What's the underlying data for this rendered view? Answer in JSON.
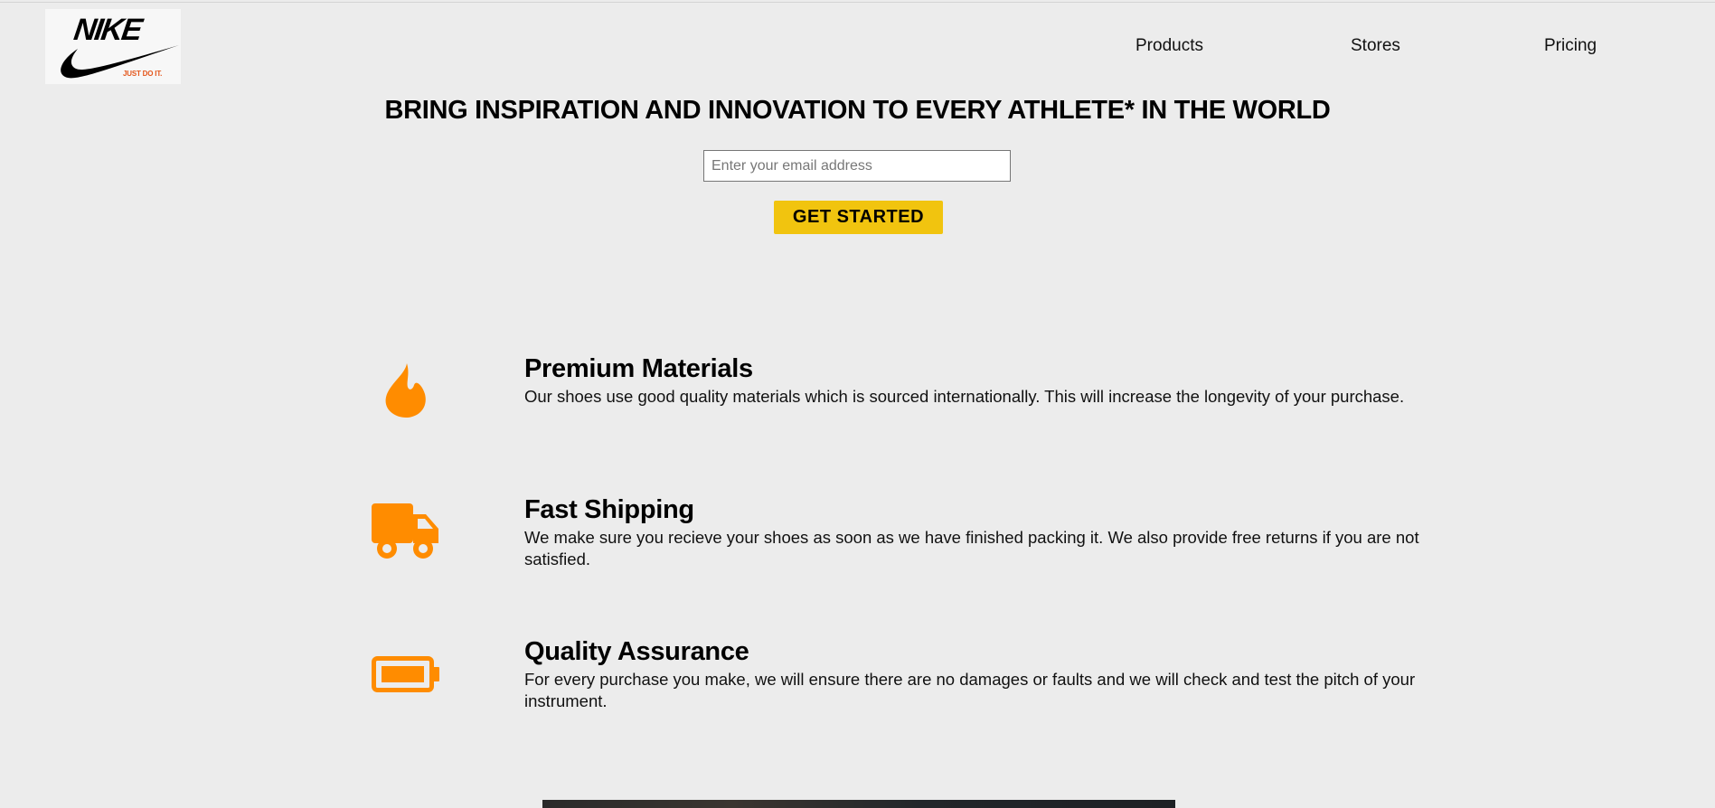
{
  "brand": {
    "wordmark": "NIKE",
    "tagline": "JUST DO IT.",
    "tagline_color": "#e4561b"
  },
  "nav": {
    "items": [
      {
        "label": "Products"
      },
      {
        "label": "Stores"
      },
      {
        "label": "Pricing"
      }
    ]
  },
  "hero": {
    "title": "BRING INSPIRATION AND INNOVATION TO EVERY ATHLETE* IN THE WORLD",
    "email_placeholder": "Enter your email address",
    "email_value": "",
    "cta_label": "GET STARTED",
    "cta_color": "#f1c40f"
  },
  "features": [
    {
      "icon": "fire-icon",
      "title": "Premium Materials",
      "description": "Our shoes use good quality materials which is sourced internationally. This will increase the longevity of your purchase."
    },
    {
      "icon": "truck-icon",
      "title": "Fast Shipping",
      "description": "We make sure you recieve your shoes as soon as we have finished packing it. We also provide free returns if you are not satisfied."
    },
    {
      "icon": "battery-icon",
      "title": "Quality Assurance",
      "description": "For every purchase you make, we will ensure there are no damages or faults and we will check and test the pitch of your instrument."
    }
  ],
  "colors": {
    "background": "#ececec",
    "icon_accent": "#ff8c00"
  }
}
